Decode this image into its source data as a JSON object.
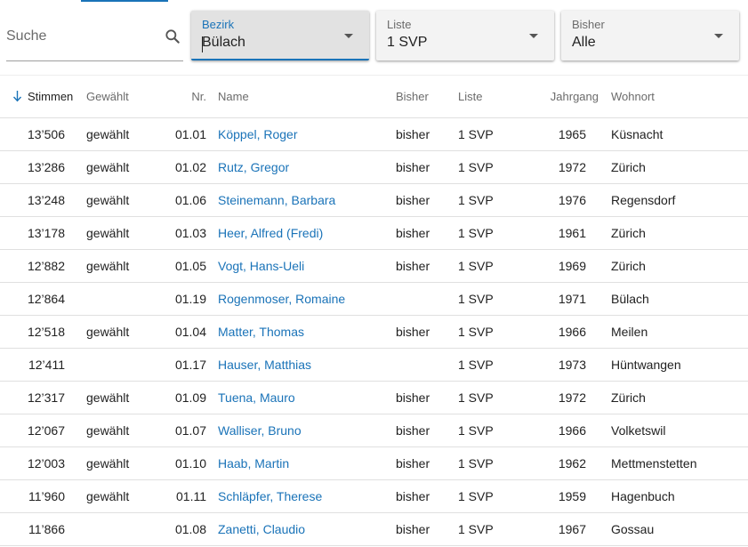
{
  "filters": {
    "search": {
      "placeholder": "Suche",
      "value": ""
    },
    "bezirk": {
      "label": "Bezirk",
      "value": "Bülach"
    },
    "liste": {
      "label": "Liste",
      "value": "1 SVP"
    },
    "bisher": {
      "label": "Bisher",
      "value": "Alle"
    }
  },
  "table": {
    "columns": {
      "stimmen": "Stimmen",
      "gewaehlt": "Gewählt",
      "nr": "Nr.",
      "name": "Name",
      "bisher": "Bisher",
      "liste": "Liste",
      "jahrgang": "Jahrgang",
      "wohnort": "Wohnort"
    },
    "sort": {
      "column": "stimmen",
      "direction": "desc"
    },
    "rows": [
      {
        "stimmen": "13’506",
        "gewaehlt": "gewählt",
        "nr": "01.01",
        "name": "Köppel, Roger",
        "bisher": "bisher",
        "liste": "1 SVP",
        "jahrgang": "1965",
        "wohnort": "Küsnacht"
      },
      {
        "stimmen": "13’286",
        "gewaehlt": "gewählt",
        "nr": "01.02",
        "name": "Rutz, Gregor",
        "bisher": "bisher",
        "liste": "1 SVP",
        "jahrgang": "1972",
        "wohnort": "Zürich"
      },
      {
        "stimmen": "13’248",
        "gewaehlt": "gewählt",
        "nr": "01.06",
        "name": "Steinemann, Barbara",
        "bisher": "bisher",
        "liste": "1 SVP",
        "jahrgang": "1976",
        "wohnort": "Regensdorf"
      },
      {
        "stimmen": "13’178",
        "gewaehlt": "gewählt",
        "nr": "01.03",
        "name": "Heer, Alfred (Fredi)",
        "bisher": "bisher",
        "liste": "1 SVP",
        "jahrgang": "1961",
        "wohnort": "Zürich"
      },
      {
        "stimmen": "12’882",
        "gewaehlt": "gewählt",
        "nr": "01.05",
        "name": "Vogt, Hans-Ueli",
        "bisher": "bisher",
        "liste": "1 SVP",
        "jahrgang": "1969",
        "wohnort": "Zürich"
      },
      {
        "stimmen": "12’864",
        "gewaehlt": "",
        "nr": "01.19",
        "name": "Rogenmoser, Romaine",
        "bisher": "",
        "liste": "1 SVP",
        "jahrgang": "1971",
        "wohnort": "Bülach"
      },
      {
        "stimmen": "12’518",
        "gewaehlt": "gewählt",
        "nr": "01.04",
        "name": "Matter, Thomas",
        "bisher": "bisher",
        "liste": "1 SVP",
        "jahrgang": "1966",
        "wohnort": "Meilen"
      },
      {
        "stimmen": "12’411",
        "gewaehlt": "",
        "nr": "01.17",
        "name": "Hauser, Matthias",
        "bisher": "",
        "liste": "1 SVP",
        "jahrgang": "1973",
        "wohnort": "Hüntwangen"
      },
      {
        "stimmen": "12’317",
        "gewaehlt": "gewählt",
        "nr": "01.09",
        "name": "Tuena, Mauro",
        "bisher": "bisher",
        "liste": "1 SVP",
        "jahrgang": "1972",
        "wohnort": "Zürich"
      },
      {
        "stimmen": "12’067",
        "gewaehlt": "gewählt",
        "nr": "01.07",
        "name": "Walliser, Bruno",
        "bisher": "bisher",
        "liste": "1 SVP",
        "jahrgang": "1966",
        "wohnort": "Volketswil"
      },
      {
        "stimmen": "12’003",
        "gewaehlt": "gewählt",
        "nr": "01.10",
        "name": "Haab, Martin",
        "bisher": "bisher",
        "liste": "1 SVP",
        "jahrgang": "1962",
        "wohnort": "Mettmenstetten"
      },
      {
        "stimmen": "11’960",
        "gewaehlt": "gewählt",
        "nr": "01.11",
        "name": "Schläpfer, Therese",
        "bisher": "bisher",
        "liste": "1 SVP",
        "jahrgang": "1959",
        "wohnort": "Hagenbuch"
      },
      {
        "stimmen": "11’866",
        "gewaehlt": "",
        "nr": "01.08",
        "name": "Zanetti, Claudio",
        "bisher": "bisher",
        "liste": "1 SVP",
        "jahrgang": "1967",
        "wohnort": "Gossau"
      }
    ]
  },
  "icons": {
    "search": "search-icon",
    "sort": "arrow-down-icon",
    "dropdown": "chevron-down-icon"
  },
  "colors": {
    "accent": "#1a73b8",
    "text": "#212121",
    "muted": "#6b6b6b",
    "divider": "#e0e0e0"
  }
}
